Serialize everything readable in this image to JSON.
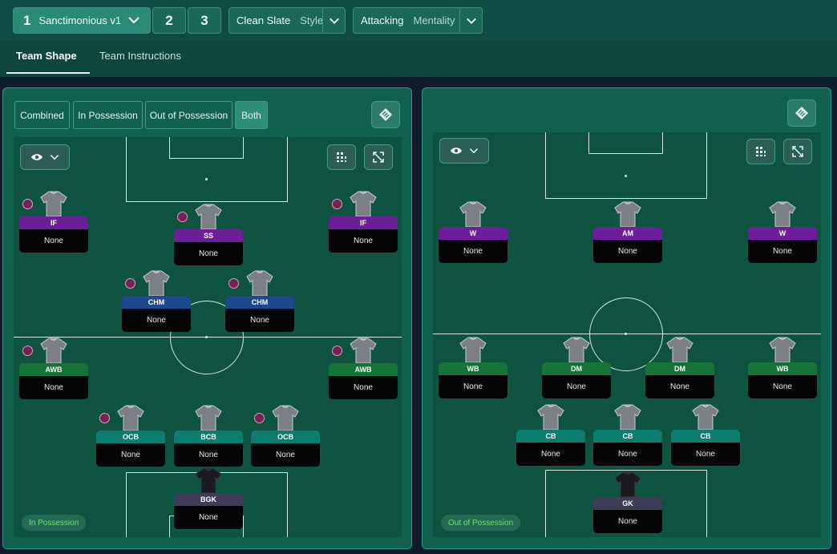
{
  "tactics": {
    "active_number": "1",
    "active_name": "Sanctimonious v1",
    "slot2": "2",
    "slot3": "3",
    "style_value": "Clean Slate",
    "style_label": "Style",
    "mentality_value": "Attacking",
    "mentality_label": "Mentality"
  },
  "tabs": [
    "Team Shape",
    "Team Instructions"
  ],
  "left_panel": {
    "segments": [
      "Combined",
      "In Possession",
      "Out of Possession",
      "Both"
    ],
    "active_segment": "Both",
    "badge": "In Possession",
    "players": [
      {
        "role": "IF",
        "duty": "None",
        "color": "purple"
      },
      {
        "role": "SS",
        "duty": "None",
        "color": "purple"
      },
      {
        "role": "IF",
        "duty": "None",
        "color": "purple"
      },
      {
        "role": "CHM",
        "duty": "None",
        "color": "blue"
      },
      {
        "role": "CHM",
        "duty": "None",
        "color": "blue"
      },
      {
        "role": "AWB",
        "duty": "None",
        "color": "green"
      },
      {
        "role": "AWB",
        "duty": "None",
        "color": "green"
      },
      {
        "role": "OCB",
        "duty": "None",
        "color": "teal"
      },
      {
        "role": "BCB",
        "duty": "None",
        "color": "teal"
      },
      {
        "role": "OCB",
        "duty": "None",
        "color": "teal"
      },
      {
        "role": "BGK",
        "duty": "None",
        "color": "gray"
      }
    ]
  },
  "right_panel": {
    "badge": "Out of Possession",
    "players": [
      {
        "role": "W",
        "duty": "None",
        "color": "purple"
      },
      {
        "role": "AM",
        "duty": "None",
        "color": "purple"
      },
      {
        "role": "W",
        "duty": "None",
        "color": "purple"
      },
      {
        "role": "WB",
        "duty": "None",
        "color": "green"
      },
      {
        "role": "DM",
        "duty": "None",
        "color": "green"
      },
      {
        "role": "DM",
        "duty": "None",
        "color": "green"
      },
      {
        "role": "WB",
        "duty": "None",
        "color": "green"
      },
      {
        "role": "CB",
        "duty": "None",
        "color": "teal"
      },
      {
        "role": "CB",
        "duty": "None",
        "color": "teal"
      },
      {
        "role": "CB",
        "duty": "None",
        "color": "teal"
      },
      {
        "role": "GK",
        "duty": "None",
        "color": "gray"
      }
    ]
  },
  "icons": {
    "chevron": "chevron-down-icon",
    "eye": "eye-icon",
    "grid": "grid-icon",
    "expand": "expand-icon",
    "tactics_board": "tactics-board-icon"
  }
}
